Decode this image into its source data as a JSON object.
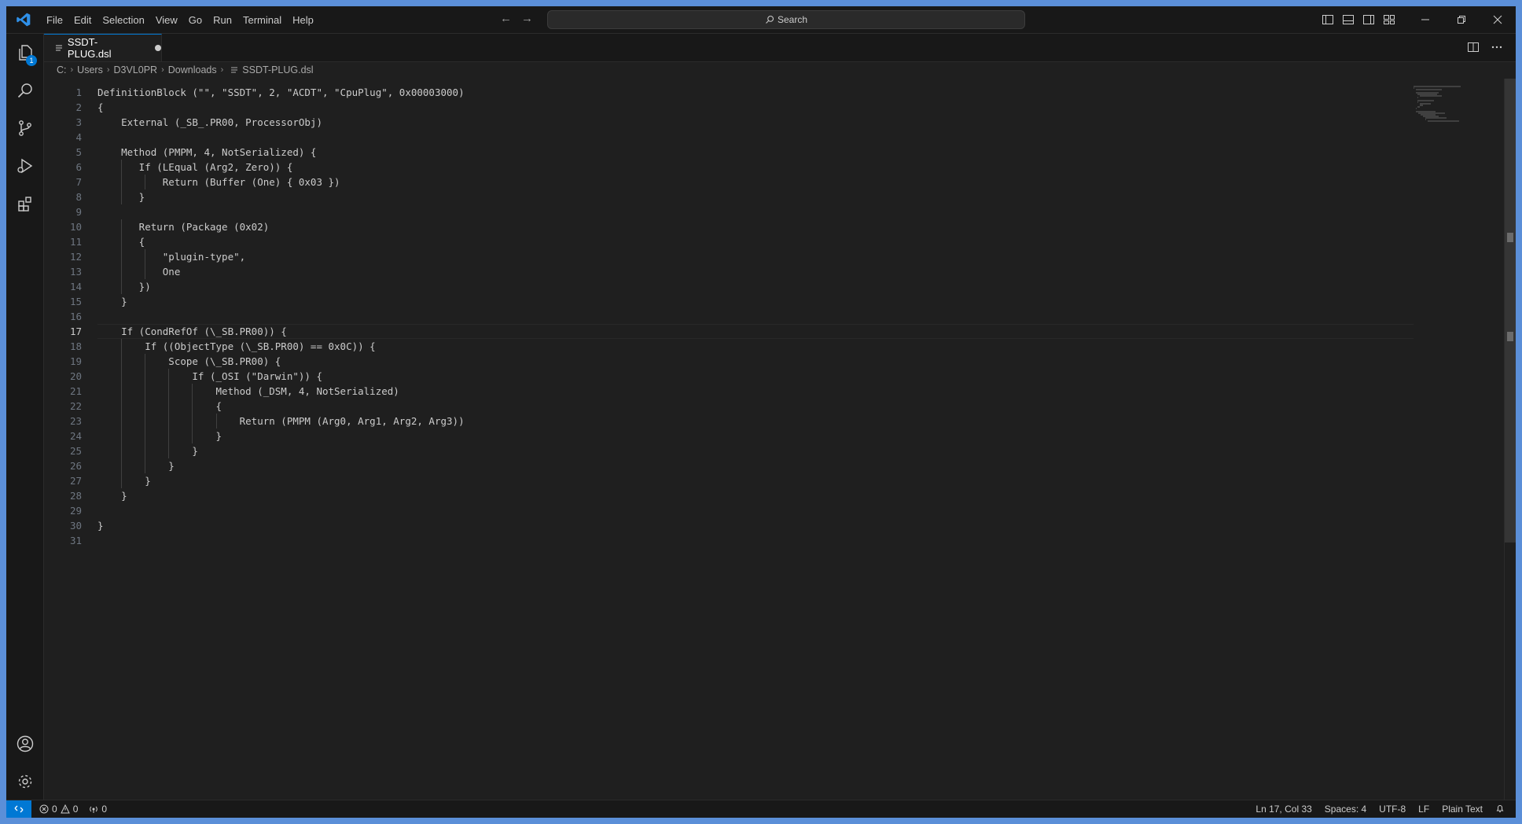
{
  "menu": [
    "File",
    "Edit",
    "Selection",
    "View",
    "Go",
    "Run",
    "Terminal",
    "Help"
  ],
  "search": {
    "label": "Search"
  },
  "activity": {
    "explorer_badge": "1"
  },
  "tab": {
    "filename": "SSDT-PLUG.dsl"
  },
  "breadcrumb": [
    "C:",
    "Users",
    "D3VL0PR",
    "Downloads",
    "SSDT-PLUG.dsl"
  ],
  "editor": {
    "active_line": 17,
    "lines": [
      "DefinitionBlock (\"\", \"SSDT\", 2, \"ACDT\", \"CpuPlug\", 0x00003000)",
      "{",
      "    External (_SB_.PR00, ProcessorObj)",
      "",
      "    Method (PMPM, 4, NotSerialized) {",
      "       If (LEqual (Arg2, Zero)) {",
      "           Return (Buffer (One) { 0x03 })",
      "       }",
      "",
      "       Return (Package (0x02)",
      "       {",
      "           \"plugin-type\",",
      "           One",
      "       })",
      "    }",
      "",
      "    If (CondRefOf (\\_SB.PR00)) {",
      "        If ((ObjectType (\\_SB.PR00) == 0x0C)) {",
      "            Scope (\\_SB.PR00) {",
      "                If (_OSI (\"Darwin\")) {",
      "                    Method (_DSM, 4, NotSerialized)",
      "                    {",
      "                        Return (PMPM (Arg0, Arg1, Arg2, Arg3))",
      "                    }",
      "                }",
      "            }",
      "        }",
      "    }",
      "",
      "}",
      ""
    ]
  },
  "status": {
    "errors": "0",
    "warnings": "0",
    "ports": "0",
    "position": "Ln 17, Col 33",
    "spaces": "Spaces: 4",
    "encoding": "UTF-8",
    "eol": "LF",
    "language": "Plain Text"
  }
}
